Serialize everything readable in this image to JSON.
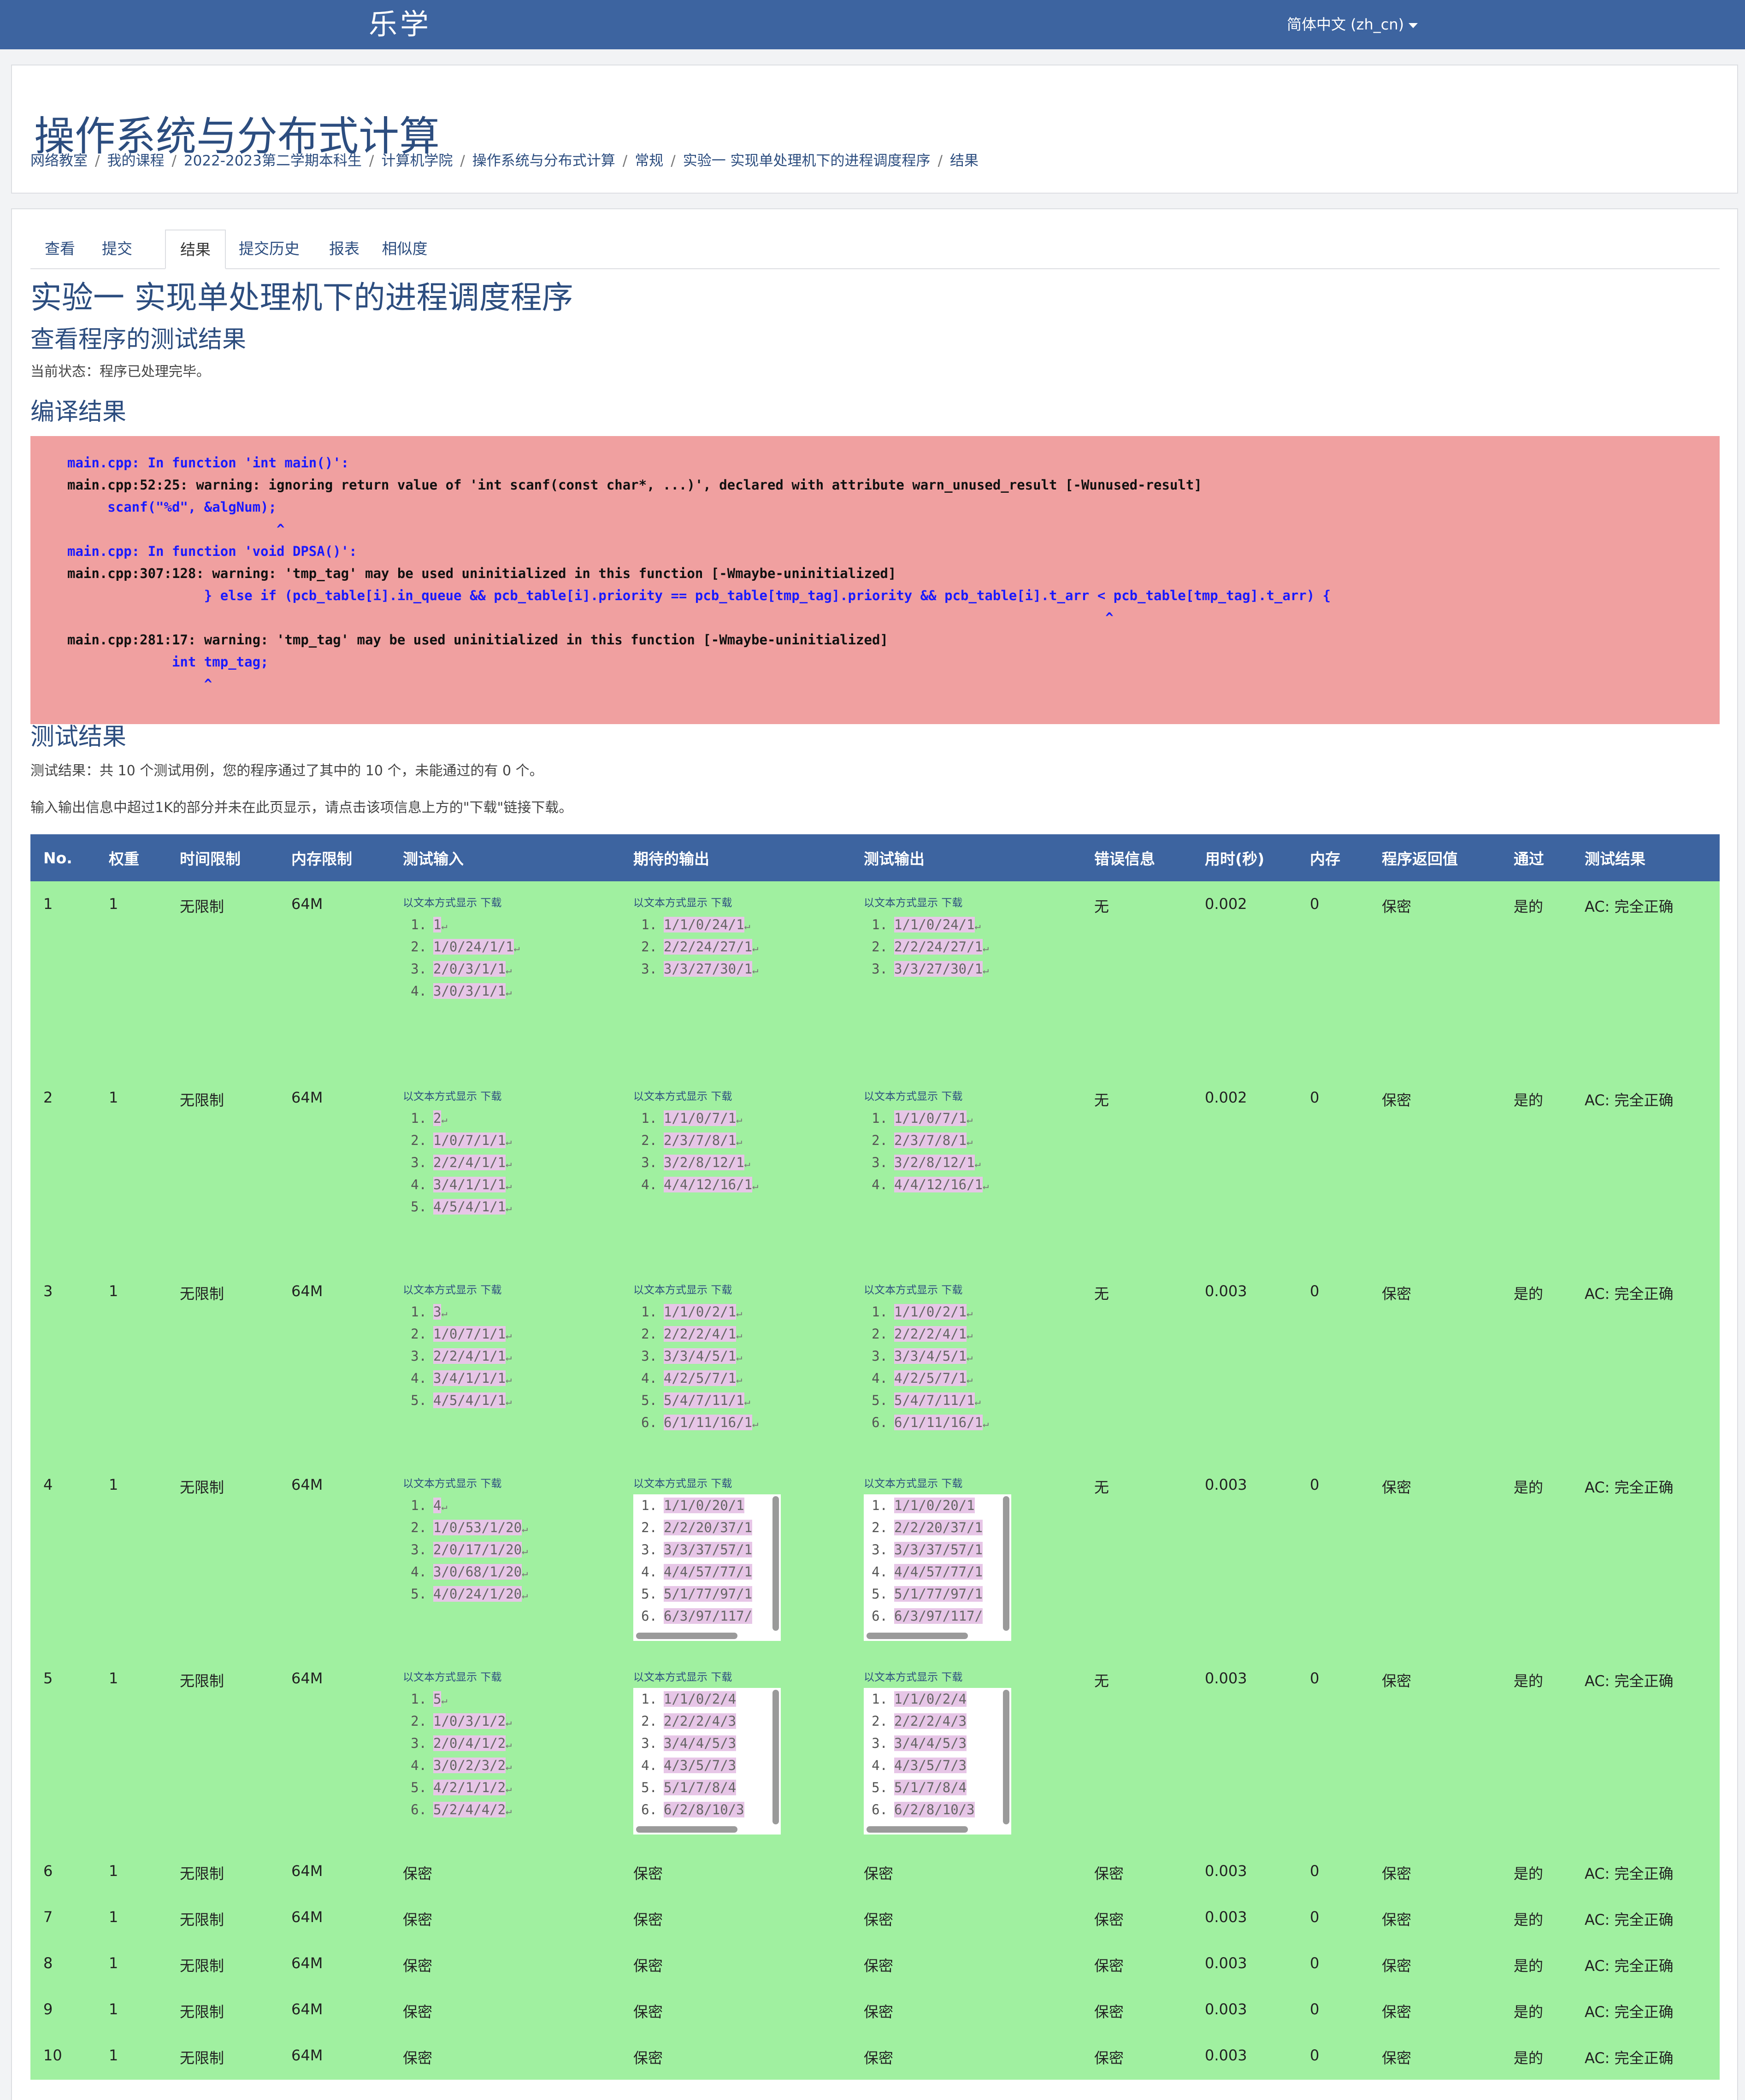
{
  "app": {
    "logo": "乐学",
    "language": "简体中文 (zh_cn)"
  },
  "header": {
    "course_title": "操作系统与分布式计算",
    "breadcrumb": [
      "网络教室",
      "我的课程",
      "2022-2023第二学期本科生",
      "计算机学院",
      "操作系统与分布式计算",
      "常规",
      "实验一 实现单处理机下的进程调度程序",
      "结果"
    ]
  },
  "tabs": [
    "查看",
    "提交",
    "结果",
    "提交历史",
    "报表",
    "相似度"
  ],
  "active_tab": "结果",
  "assignment": {
    "title": "实验一 实现单处理机下的进程调度程序",
    "subtitle": "查看程序的测试结果",
    "status": "当前状态：程序已处理完毕。"
  },
  "compile": {
    "heading": "编译结果",
    "lines": [
      {
        "text": "main.cpp: In function 'int main()':",
        "blue": true
      },
      {
        "text": "main.cpp:52:25: warning: ignoring return value of 'int scanf(const char*, ...)', declared with attribute warn_unused_result [-Wunused-result]",
        "blue": false
      },
      {
        "text": "     scanf(\"%d\", &algNum);",
        "blue": true
      },
      {
        "text": "                          ^",
        "blue": true
      },
      {
        "text": "main.cpp: In function 'void DPSA()':",
        "blue": true
      },
      {
        "text": "main.cpp:307:128: warning: 'tmp_tag' may be used uninitialized in this function [-Wmaybe-uninitialized]",
        "blue": false
      },
      {
        "text": "                 } else if (pcb_table[i].in_queue && pcb_table[i].priority == pcb_table[tmp_tag].priority && pcb_table[i].t_arr < pcb_table[tmp_tag].t_arr) {",
        "blue": true
      },
      {
        "text": "                                                                                                                                 ^",
        "blue": true
      },
      {
        "text": "main.cpp:281:17: warning: 'tmp_tag' may be used uninitialized in this function [-Wmaybe-uninitialized]",
        "blue": false
      },
      {
        "text": "             int tmp_tag;",
        "blue": true
      },
      {
        "text": "                 ^",
        "blue": true
      }
    ]
  },
  "tests": {
    "heading": "测试结果",
    "summary": "测试结果：共 10 个测试用例，您的程序通过了其中的 10 个，未能通过的有 0 个。",
    "note": "输入输出信息中超过1K的部分并未在此页显示，请点击该项信息上方的\"下载\"链接下载。",
    "columns": [
      "No.",
      "权重",
      "时间限制",
      "内存限制",
      "测试输入",
      "期待的输出",
      "测试输出",
      "错误信息",
      "用时(秒)",
      "内存",
      "程序返回值",
      "通过",
      "测试结果"
    ],
    "io_links": {
      "show_text": "以文本方式显示",
      "download": "下载"
    },
    "rows": [
      {
        "no": "1",
        "weight": "1",
        "time_limit": "无限制",
        "mem_limit": "64M",
        "input": [
          "1",
          "1/0/24/1/1",
          "2/0/3/1/1",
          "3/0/3/1/1"
        ],
        "expected": [
          "1/1/0/24/1",
          "2/2/24/27/1",
          "3/3/27/30/1"
        ],
        "output": [
          "1/1/0/24/1",
          "2/2/24/27/1",
          "3/3/27/30/1"
        ],
        "expected_scroll": false,
        "output_scroll": false,
        "error": "无",
        "time": "0.002",
        "memory": "0",
        "retval": "保密",
        "pass": "是的",
        "result": "AC: 完全正确"
      },
      {
        "no": "2",
        "weight": "1",
        "time_limit": "无限制",
        "mem_limit": "64M",
        "input": [
          "2",
          "1/0/7/1/1",
          "2/2/4/1/1",
          "3/4/1/1/1",
          "4/5/4/1/1"
        ],
        "expected": [
          "1/1/0/7/1",
          "2/3/7/8/1",
          "3/2/8/12/1",
          "4/4/12/16/1"
        ],
        "output": [
          "1/1/0/7/1",
          "2/3/7/8/1",
          "3/2/8/12/1",
          "4/4/12/16/1"
        ],
        "expected_scroll": false,
        "output_scroll": false,
        "error": "无",
        "time": "0.002",
        "memory": "0",
        "retval": "保密",
        "pass": "是的",
        "result": "AC: 完全正确"
      },
      {
        "no": "3",
        "weight": "1",
        "time_limit": "无限制",
        "mem_limit": "64M",
        "input": [
          "3",
          "1/0/7/1/1",
          "2/2/4/1/1",
          "3/4/1/1/1",
          "4/5/4/1/1"
        ],
        "expected": [
          "1/1/0/2/1",
          "2/2/2/4/1",
          "3/3/4/5/1",
          "4/2/5/7/1",
          "5/4/7/11/1",
          "6/1/11/16/1"
        ],
        "output": [
          "1/1/0/2/1",
          "2/2/2/4/1",
          "3/3/4/5/1",
          "4/2/5/7/1",
          "5/4/7/11/1",
          "6/1/11/16/1"
        ],
        "expected_scroll": false,
        "output_scroll": false,
        "error": "无",
        "time": "0.003",
        "memory": "0",
        "retval": "保密",
        "pass": "是的",
        "result": "AC: 完全正确"
      },
      {
        "no": "4",
        "weight": "1",
        "time_limit": "无限制",
        "mem_limit": "64M",
        "input": [
          "4",
          "1/0/53/1/20",
          "2/0/17/1/20",
          "3/0/68/1/20",
          "4/0/24/1/20"
        ],
        "expected": [
          "1/1/0/20/1",
          "2/2/20/37/1",
          "3/3/37/57/1",
          "4/4/57/77/1",
          "5/1/77/97/1",
          "6/3/97/117/"
        ],
        "output": [
          "1/1/0/20/1",
          "2/2/20/37/1",
          "3/3/37/57/1",
          "4/4/57/77/1",
          "5/1/77/97/1",
          "6/3/97/117/"
        ],
        "expected_scroll": true,
        "output_scroll": true,
        "error": "无",
        "time": "0.003",
        "memory": "0",
        "retval": "保密",
        "pass": "是的",
        "result": "AC: 完全正确"
      },
      {
        "no": "5",
        "weight": "1",
        "time_limit": "无限制",
        "mem_limit": "64M",
        "input": [
          "5",
          "1/0/3/1/2",
          "2/0/4/1/2",
          "3/0/2/3/2",
          "4/2/1/1/2",
          "5/2/4/4/2"
        ],
        "expected": [
          "1/1/0/2/4",
          "2/2/2/4/3",
          "3/4/4/5/3",
          "4/3/5/7/3",
          "5/1/7/8/4",
          "6/2/8/10/3"
        ],
        "output": [
          "1/1/0/2/4",
          "2/2/2/4/3",
          "3/4/4/5/3",
          "4/3/5/7/3",
          "5/1/7/8/4",
          "6/2/8/10/3"
        ],
        "expected_scroll": true,
        "output_scroll": true,
        "error": "无",
        "time": "0.003",
        "memory": "0",
        "retval": "保密",
        "pass": "是的",
        "result": "AC: 完全正确"
      },
      {
        "no": "6",
        "weight": "1",
        "time_limit": "无限制",
        "mem_limit": "64M",
        "input_text": "保密",
        "expected_text": "保密",
        "output_text": "保密",
        "error": "保密",
        "time": "0.003",
        "memory": "0",
        "retval": "保密",
        "pass": "是的",
        "result": "AC: 完全正确"
      },
      {
        "no": "7",
        "weight": "1",
        "time_limit": "无限制",
        "mem_limit": "64M",
        "input_text": "保密",
        "expected_text": "保密",
        "output_text": "保密",
        "error": "保密",
        "time": "0.003",
        "memory": "0",
        "retval": "保密",
        "pass": "是的",
        "result": "AC: 完全正确"
      },
      {
        "no": "8",
        "weight": "1",
        "time_limit": "无限制",
        "mem_limit": "64M",
        "input_text": "保密",
        "expected_text": "保密",
        "output_text": "保密",
        "error": "保密",
        "time": "0.003",
        "memory": "0",
        "retval": "保密",
        "pass": "是的",
        "result": "AC: 完全正确"
      },
      {
        "no": "9",
        "weight": "1",
        "time_limit": "无限制",
        "mem_limit": "64M",
        "input_text": "保密",
        "expected_text": "保密",
        "output_text": "保密",
        "error": "保密",
        "time": "0.003",
        "memory": "0",
        "retval": "保密",
        "pass": "是的",
        "result": "AC: 完全正确"
      },
      {
        "no": "10",
        "weight": "1",
        "time_limit": "无限制",
        "mem_limit": "64M",
        "input_text": "保密",
        "expected_text": "保密",
        "output_text": "保密",
        "error": "保密",
        "time": "0.003",
        "memory": "0",
        "retval": "保密",
        "pass": "是的",
        "result": "AC: 完全正确"
      }
    ]
  },
  "colors": {
    "nav": "#3d64a0",
    "link": "#2c4d7f",
    "compile_bg": "#f0a0a0",
    "pass_bg": "#a0f0a0",
    "io_highlight": "#e7c6e7"
  }
}
